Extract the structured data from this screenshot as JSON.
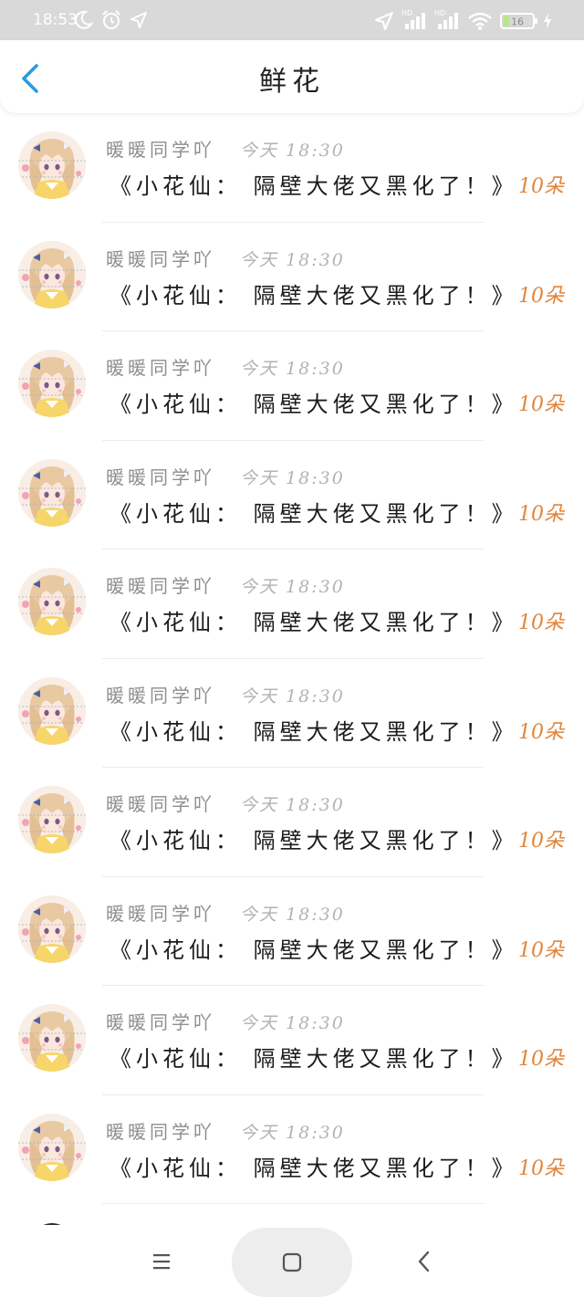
{
  "status_bar": {
    "time": "18:53",
    "battery_level": "16",
    "icons": [
      "moon-icon",
      "alarm-icon",
      "location-icon",
      "location-icon",
      "signal-icon",
      "signal-icon",
      "wifi-icon",
      "battery-icon",
      "charging-icon"
    ],
    "network_labels": [
      "HD",
      "HD"
    ]
  },
  "header": {
    "title": "鲜花",
    "back_icon": "chevron-left-icon"
  },
  "items": [
    {
      "sender": "暖暖同学吖",
      "time": "今天 18:30",
      "title": "《小花仙：  隔壁大佬又黑化了！》",
      "amount": "10朵"
    },
    {
      "sender": "暖暖同学吖",
      "time": "今天 18:30",
      "title": "《小花仙：  隔壁大佬又黑化了！》",
      "amount": "10朵"
    },
    {
      "sender": "暖暖同学吖",
      "time": "今天 18:30",
      "title": "《小花仙：  隔壁大佬又黑化了！》",
      "amount": "10朵"
    },
    {
      "sender": "暖暖同学吖",
      "time": "今天 18:30",
      "title": "《小花仙：  隔壁大佬又黑化了！》",
      "amount": "10朵"
    },
    {
      "sender": "暖暖同学吖",
      "time": "今天 18:30",
      "title": "《小花仙：  隔壁大佬又黑化了！》",
      "amount": "10朵"
    },
    {
      "sender": "暖暖同学吖",
      "time": "今天 18:30",
      "title": "《小花仙：  隔壁大佬又黑化了！》",
      "amount": "10朵"
    },
    {
      "sender": "暖暖同学吖",
      "time": "今天 18:30",
      "title": "《小花仙：  隔壁大佬又黑化了！》",
      "amount": "10朵"
    },
    {
      "sender": "暖暖同学吖",
      "time": "今天 18:30",
      "title": "《小花仙：  隔壁大佬又黑化了！》",
      "amount": "10朵"
    },
    {
      "sender": "暖暖同学吖",
      "time": "今天 18:30",
      "title": "《小花仙：  隔壁大佬又黑化了！》",
      "amount": "10朵"
    },
    {
      "sender": "暖暖同学吖",
      "time": "今天 18:30",
      "title": "《小花仙：  隔壁大佬又黑化了！》",
      "amount": "10朵"
    }
  ],
  "nav_bar": {
    "icons": [
      "menu-icon",
      "home-icon",
      "back-icon"
    ]
  },
  "colors": {
    "accent_blue": "#2a9be0",
    "amount_orange": "#e2853a",
    "status_bar_bg": "#d9d9d9"
  }
}
